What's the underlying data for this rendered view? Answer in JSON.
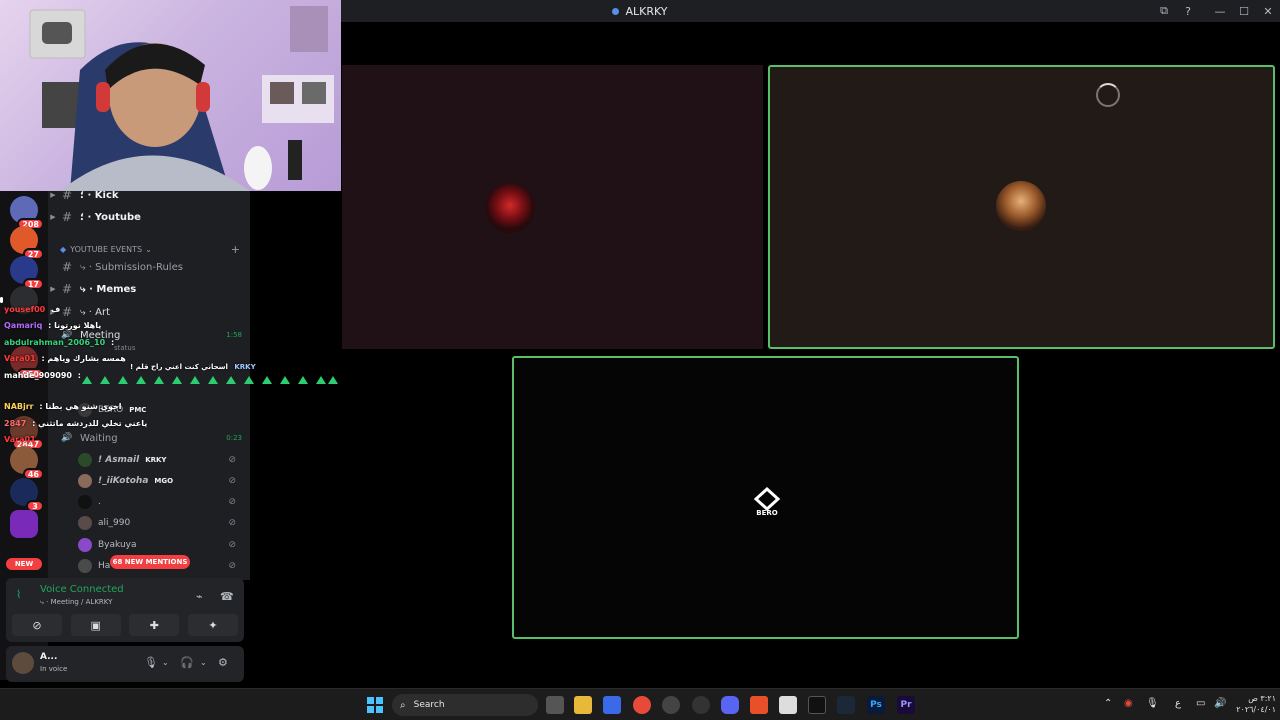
{
  "window": {
    "title": "ALKRKY",
    "controls": {
      "screen_share": "⧉",
      "help": "?",
      "minimize": "—",
      "maximize": "☐",
      "close": "✕"
    }
  },
  "rail": {
    "servers": [
      {
        "badge": "208"
      },
      {
        "badge": "27"
      },
      {
        "badge": "17"
      },
      {
        "badge": ""
      },
      {
        "badge": "950"
      },
      {
        "badge": "2847"
      },
      {
        "badge": "46"
      },
      {
        "badge": "3"
      },
      {
        "badge": ""
      }
    ],
    "new_label": "NEW"
  },
  "channels": {
    "kick": "؛ · Kick",
    "youtube": "؛ · Youtube",
    "category": "YOUTUBE EVENTS",
    "submission_rules": "⤷ · Submission-Rules",
    "memes": "⤷ · Memes",
    "art": "⤷ · Art",
    "meeting": "Meeting",
    "meeting_time": "1:58",
    "meeting_status": "status",
    "waiting": "Waiting",
    "waiting_time": "0:23"
  },
  "voice_users": [
    {
      "name": "BERO",
      "tag": "PMC"
    },
    {
      "name": "! Asmail",
      "tag": "KRKY"
    },
    {
      "name": "!_iiKotoha",
      "tag": "MGO"
    },
    {
      "name": ".",
      "tag": ""
    },
    {
      "name": "ali_990",
      "tag": ""
    },
    {
      "name": "Byakuya",
      "tag": ""
    },
    {
      "name": "Ha",
      "tag": ""
    }
  ],
  "mentions_label": "68 NEW MENTIONS",
  "voice_panel": {
    "status": "Voice Connected",
    "location": "⤷ · Meeting / ALKRKY"
  },
  "user_bar": {
    "name": "A...",
    "status": "In voice"
  },
  "chat": [
    {
      "user": "yousef00",
      "text": "ف",
      "color": "#ff3b3b"
    },
    {
      "user": "Qamariq",
      "text": ": ياهلا نورتونا",
      "color": "#b36bff"
    },
    {
      "user": "abdulrahman_2006_10",
      "text": ":",
      "color": "#35d27d"
    },
    {
      "user": "Vara01",
      "text": ": همسه بشارك وياهم",
      "color": "#ff3b3b"
    },
    {
      "user": "mahde_909090",
      "text": ":",
      "color": "#ffffff"
    },
    {
      "user": "NABjrr",
      "text": ": اخوي شنو هي بطنا",
      "color": "#ffd35a"
    },
    {
      "user": "2847",
      "text": ": ياعني تخلي للدردشه ماتثني",
      "color": "#ff6b6b"
    },
    {
      "user": "Vara01",
      "text": "",
      "color": "#ff3b3b"
    }
  ],
  "chat_extras": {
    "mid_line": "! اسحاني كنت اعني راح قلم",
    "tag_krky": "KRKY"
  },
  "stream": {
    "bero_label": "BERO"
  },
  "taskbar": {
    "search": "Search",
    "apps": [
      "Ps",
      "Pr"
    ],
    "tray_lang": "ع",
    "clock_time": "٣:٢١ ص",
    "clock_date": "٢٠٢٦/٠٤/٠١"
  }
}
